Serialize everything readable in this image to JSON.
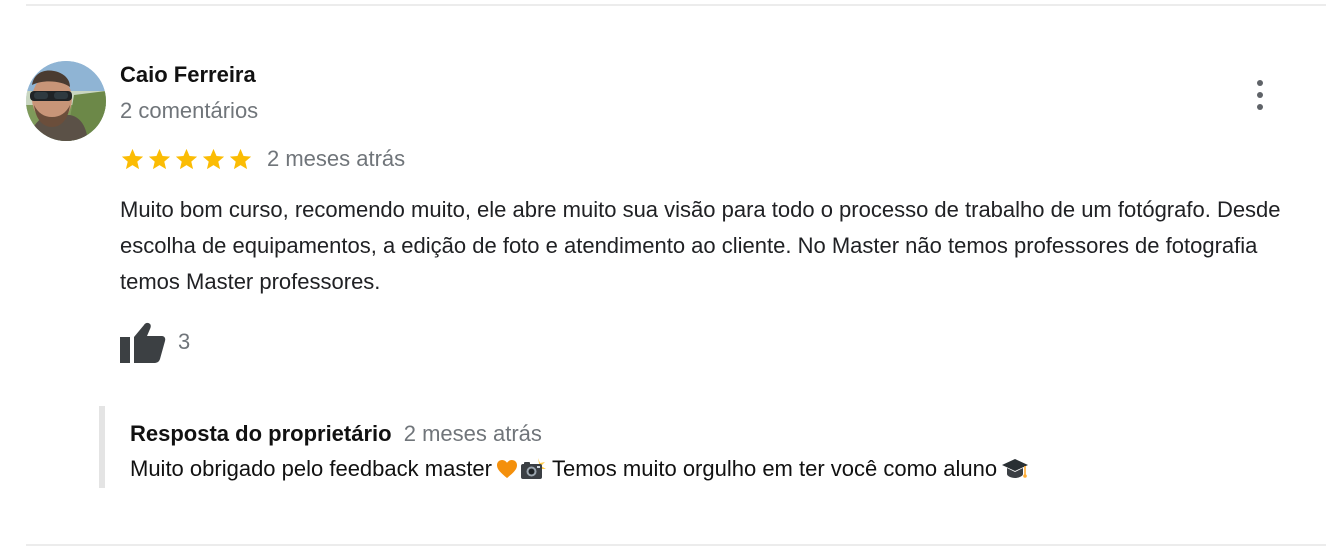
{
  "review": {
    "author_name": "Caio Ferreira",
    "author_meta": "2 comentários",
    "rating": 5,
    "rating_max": 5,
    "star_color": "#fbbc04",
    "date": "2 meses atrás",
    "text": "Muito bom curso, recomendo muito, ele abre muito sua visão para todo o processo de trabalho de um fotógrafo. Desde escolha de equipamentos, a edição de foto e atendimento ao cliente. No Master não temos professores de fotografia temos Master professores.",
    "likes": "3",
    "icons": {
      "avatar": "user-avatar-photo",
      "more": "more-vert-icon",
      "like": "thumbs-up-icon"
    }
  },
  "owner_reply": {
    "title": "Resposta do proprietário",
    "date": "2 meses atrás",
    "text_before": "Muito obrigado pelo feedback master",
    "text_after": "Temos muito orgulho em ter você como aluno",
    "emojis": [
      "orange-heart-icon",
      "camera-flash-icon",
      "graduation-cap-icon"
    ]
  }
}
